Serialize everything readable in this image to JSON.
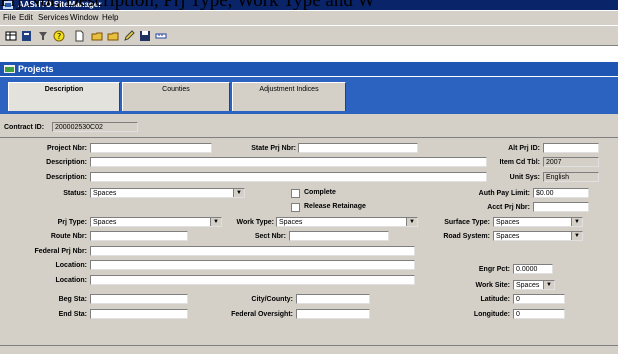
{
  "caption_fragment": "Prj Nbr, Description, Prj Type, Work Type and W",
  "window": {
    "title": "AASHTO SiteManager"
  },
  "menu": [
    "File",
    "Edit",
    "Services",
    "Window",
    "Help"
  ],
  "toolbar_icons": [
    "grid-icon",
    "report-icon",
    "filter-icon",
    "help-icon",
    "new-document-icon",
    "open-folder-icon",
    "open-folder-icon",
    "edit-icon",
    "save-icon",
    "ruler-icon"
  ],
  "panel": {
    "title": "Projects"
  },
  "tabs": [
    "Description",
    "Counties",
    "Adjustment Indices"
  ],
  "contract": {
    "label": "Contract ID:",
    "value": "200002530C02"
  },
  "labels": {
    "project_nbr": "Project Nbr:",
    "state_prj_nbr": "State Prj Nbr:",
    "alt_prj_id": "Alt Prj ID:",
    "description": "Description:",
    "item_cd_tbl": "Item Cd Tbl:",
    "description2": "Description:",
    "unit_sys": "Unit Sys:",
    "status": "Status:",
    "complete": "Complete",
    "release_retainage": "Release Retainage",
    "auth_pay_limit": "Auth Pay Limit:",
    "acct_prj_nbr": "Acct Prj Nbr:",
    "prj_type": "Prj Type:",
    "work_type": "Work Type:",
    "surface_type": "Surface Type:",
    "route_nbr": "Route Nbr:",
    "sect_nbr": "Sect Nbr:",
    "road_system": "Road System:",
    "federal_prj_nbr": "Federal Prj Nbr:",
    "location": "Location:",
    "location2": "Location:",
    "engr_pct": "Engr Pct:",
    "work_site": "Work Site:",
    "beg_sta": "Beg Sta:",
    "city_county": "City/County:",
    "latitude": "Latitude:",
    "end_sta": "End Sta:",
    "federal_oversight": "Federal Oversight:",
    "longitude": "Longitude:"
  },
  "values": {
    "item_cd_tbl": "2007",
    "unit_sys": "English",
    "status": "Spaces",
    "auth_pay_limit": "$0.00",
    "prj_type": "Spaces",
    "work_type": "Spaces",
    "surface_type": "Spaces",
    "road_system": "Spaces",
    "engr_pct": "0.0000",
    "work_site": "Spaces",
    "latitude": "0",
    "longitude": "0"
  },
  "colors": {
    "title_bar": "#0a246a",
    "panel_header": "#1f56b4",
    "tab_strip": "#2d63c0",
    "face": "#d4d0c8"
  }
}
